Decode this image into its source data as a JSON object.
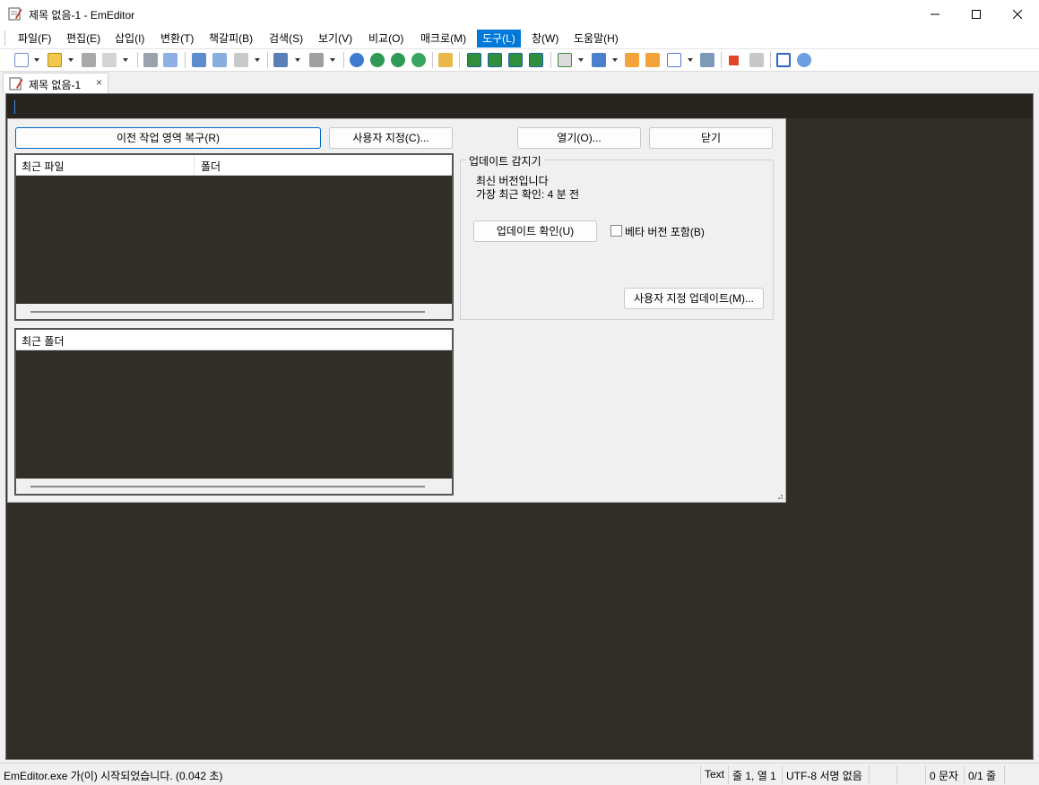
{
  "window": {
    "title": "제목 없음-1 - EmEditor",
    "minimize_glyph": "—",
    "maximize_glyph": "☐",
    "close_glyph": "✕"
  },
  "menu": [
    {
      "label": "파일(F)"
    },
    {
      "label": "편집(E)"
    },
    {
      "label": "삽입(I)"
    },
    {
      "label": "변환(T)"
    },
    {
      "label": "책갈피(B)"
    },
    {
      "label": "검색(S)"
    },
    {
      "label": "보기(V)"
    },
    {
      "label": "비교(O)"
    },
    {
      "label": "매크로(M)"
    },
    {
      "label": "도구(L)",
      "active": true
    },
    {
      "label": "창(W)"
    },
    {
      "label": "도움말(H)"
    }
  ],
  "toolbar_icons": [
    "new-file-icon",
    "open-folder-icon",
    "save-icon",
    "reload-icon",
    "print-icon",
    "print-preview-icon",
    "cut-icon",
    "copy-icon",
    "paste-icon",
    "undo-icon",
    "redo-icon",
    "find-icon",
    "find-next-icon",
    "find-prev-icon",
    "replace-icon",
    "find-in-files-icon",
    "split-view-icon",
    "refresh-icon",
    "sync-icon",
    "export-icon",
    "document-icon",
    "plugin-icon",
    "tools-icon",
    "settings-icon",
    "checkbox-icon",
    "outline-icon",
    "record-macro-icon",
    "play-macro-icon",
    "window-icon",
    "customize-icon"
  ],
  "tab": {
    "label": "제목 없음-1",
    "close_glyph": "×"
  },
  "start_panel": {
    "restore_button": "이전 작업 영역 복구(R)",
    "customize_button": "사용자 지정(C)...",
    "open_button": "열기(O)...",
    "close_button": "닫기",
    "recent_files": {
      "col_file": "최근 파일",
      "col_folder": "폴더"
    },
    "recent_folders": {
      "col_folder": "최근 폴더"
    },
    "update": {
      "legend": "업데이트 감지기",
      "status": "최신 버전입니다",
      "last_check": "가장 최근 확인: 4 분 전",
      "check_button": "업데이트 확인(U)",
      "beta_checkbox": "베타 버전 포함(B)",
      "beta_checked": false,
      "custom_update_button": "사용자 지정 업데이트(M)..."
    }
  },
  "statusbar": {
    "message": "EmEditor.exe 가(이) 시작되었습니다. (0.042 초)",
    "mode": "Text",
    "position": "줄 1, 열 1",
    "encoding": "UTF-8 서명 없음",
    "chars": "0 문자",
    "lines": "0/1 줄"
  },
  "colors": {
    "editor_bg": "#312d27",
    "accent": "#0078d7"
  }
}
